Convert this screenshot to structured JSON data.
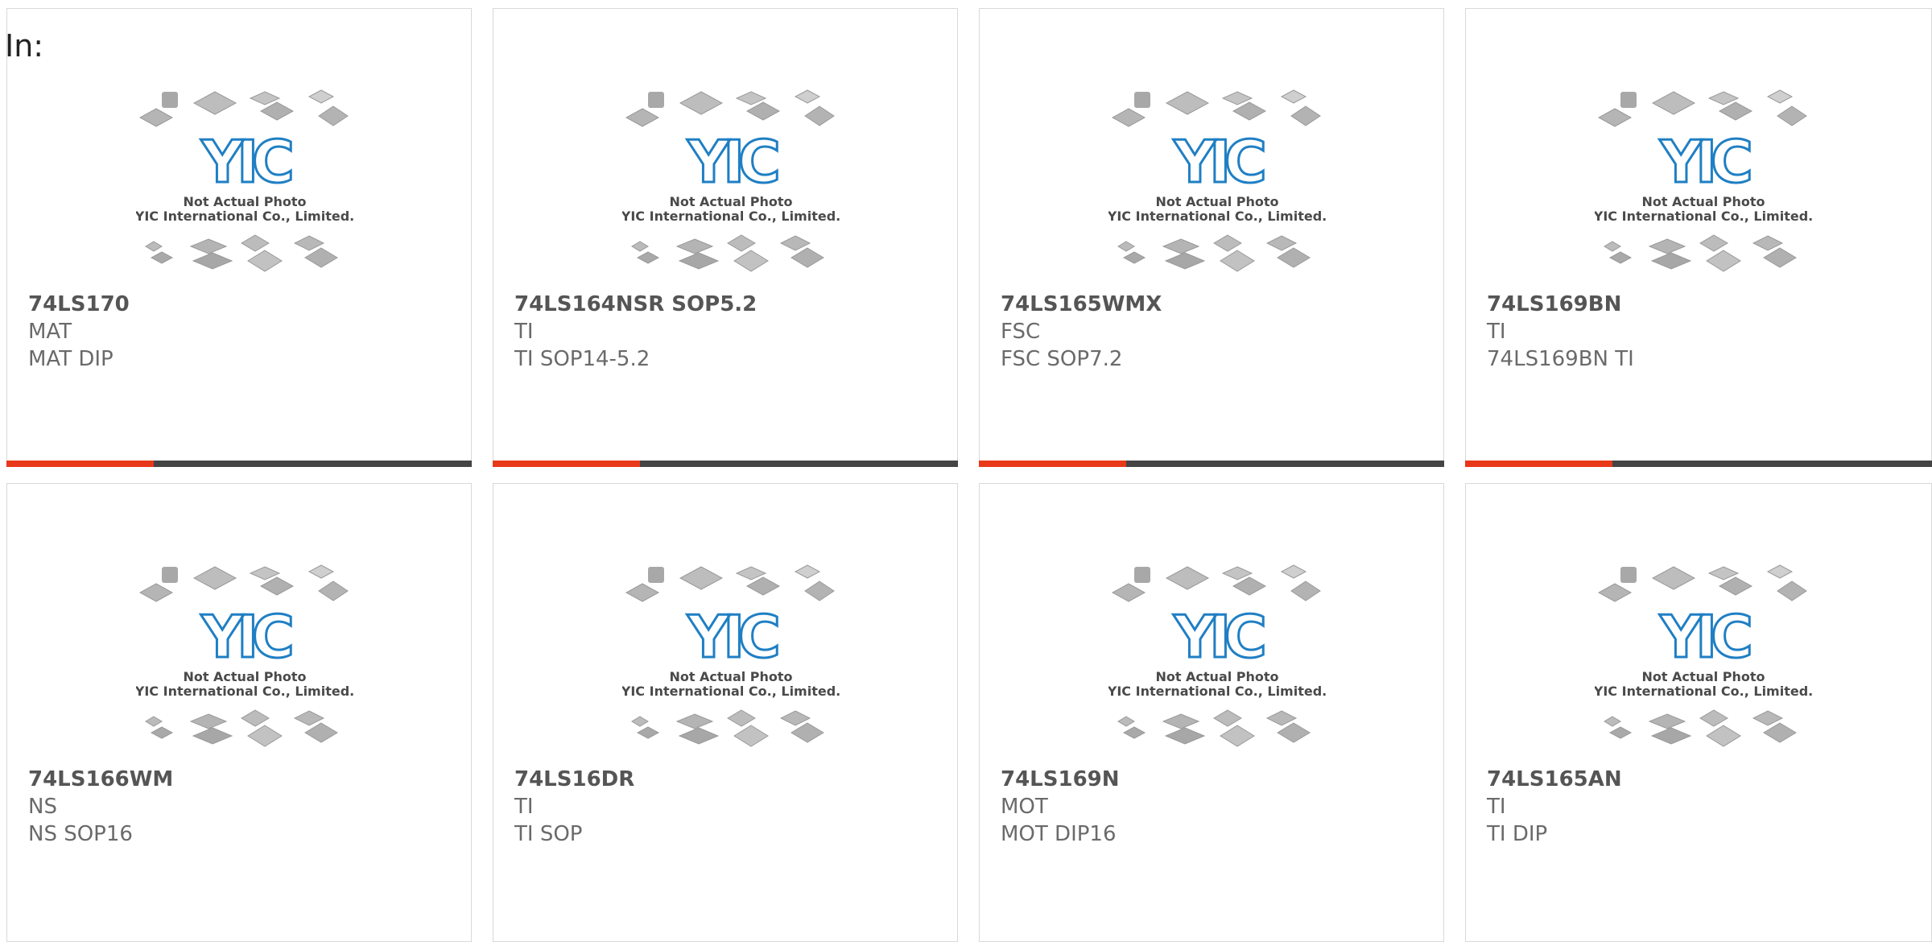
{
  "header": {
    "in_label": "In:"
  },
  "placeholder": {
    "line1": "Not Actual Photo",
    "line2": "YIC International Co., Limited.",
    "logo_text": "YIC",
    "logo_color": "#1f7fc4"
  },
  "colors": {
    "accent": "#e8381a",
    "bar_dark": "#444444"
  },
  "products": [
    {
      "part": "74LS170",
      "manufacturer": "MAT",
      "package": "MAT DIP"
    },
    {
      "part": "74LS164NSR SOP5.2",
      "manufacturer": "TI",
      "package": "TI SOP14-5.2"
    },
    {
      "part": "74LS165WMX",
      "manufacturer": "FSC",
      "package": "FSC SOP7.2"
    },
    {
      "part": "74LS169BN",
      "manufacturer": "TI",
      "package": "74LS169BN TI"
    },
    {
      "part": "74LS166WM",
      "manufacturer": "NS",
      "package": "NS SOP16"
    },
    {
      "part": "74LS16DR",
      "manufacturer": "TI",
      "package": "TI SOP"
    },
    {
      "part": "74LS169N",
      "manufacturer": "MOT",
      "package": "MOT DIP16"
    },
    {
      "part": "74LS165AN",
      "manufacturer": "TI",
      "package": "TI DIP"
    }
  ]
}
